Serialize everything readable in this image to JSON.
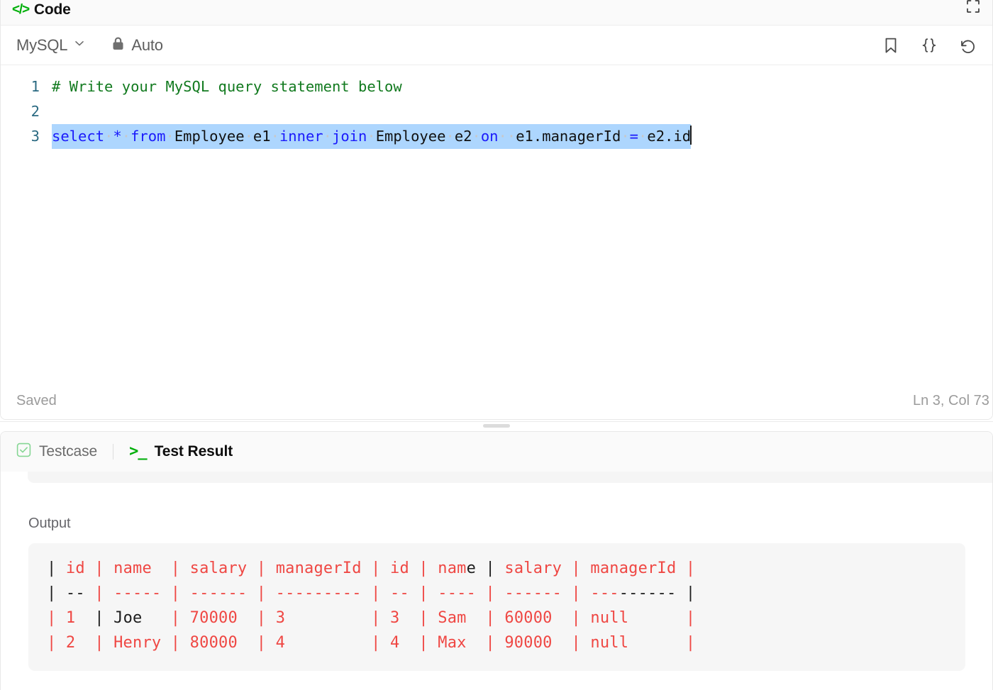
{
  "editor": {
    "header": {
      "icon": "code-brackets-icon",
      "title": "Code",
      "expand_icon": "expand-fullscreen-icon"
    },
    "toolbar": {
      "language": "MySQL",
      "language_chevron": "chevron-down-icon",
      "lock_icon": "lock-icon",
      "autocomplete_label": "Auto",
      "icons": [
        {
          "name": "bookmark-icon",
          "label": "Bookmark"
        },
        {
          "name": "curly-braces-icon",
          "label": "Format code"
        },
        {
          "name": "reset-icon",
          "label": "Reset code"
        }
      ]
    },
    "code": {
      "lines": [
        {
          "number": "1",
          "text": "# Write your MySQL query statement below"
        },
        {
          "number": "2",
          "text": ""
        },
        {
          "number": "3",
          "text": "select * from Employee e1 inner join Employee e2 on  e1.managerId = e2.id"
        }
      ],
      "line_numbers": [
        "1",
        "2",
        "3"
      ],
      "comment_text": "# Write your MySQL query statement below",
      "selected_line_tokens": [
        {
          "t": "select",
          "type": "keyword"
        },
        {
          "t": "*",
          "type": "operator"
        },
        {
          "t": "from",
          "type": "keyword"
        },
        {
          "t": "Employee",
          "type": "plain"
        },
        {
          "t": "e1",
          "type": "plain"
        },
        {
          "t": "inner",
          "type": "keyword"
        },
        {
          "t": "join",
          "type": "keyword"
        },
        {
          "t": "Employee",
          "type": "plain"
        },
        {
          "t": "e2",
          "type": "plain"
        },
        {
          "t": "on",
          "type": "keyword"
        },
        {
          "t": "e1.managerId",
          "type": "plain"
        },
        {
          "t": "=",
          "type": "operator"
        },
        {
          "t": "e2.id",
          "type": "plain"
        }
      ]
    },
    "status": {
      "saved_label": "Saved",
      "cursor_position": "Ln 3, Col 73"
    }
  },
  "console": {
    "tabs": [
      {
        "label": "Testcase",
        "icon": "check-square-icon",
        "active": false
      },
      {
        "label": "Test Result",
        "icon": "terminal-prompt-icon",
        "active": true
      }
    ],
    "output": {
      "label": "Output",
      "columns": [
        "id",
        "name",
        "salary",
        "managerId",
        "id",
        "name",
        "salary",
        "managerId"
      ],
      "rows": [
        [
          "1",
          "Joe",
          "70000",
          "3",
          "3",
          "Sam",
          "60000",
          "null"
        ],
        [
          "2",
          "Henry",
          "80000",
          "4",
          "4",
          "Max",
          "90000",
          "null"
        ]
      ],
      "raw_lines": [
        "| id | name  | salary | managerId | id | name | salary | managerId |",
        "| -- | ----- | ------ | --------- | -- | ---- | ------ | --------- |",
        "| 1  | Joe   | 70000  | 3         | 3  | Sam  | 60000  | null      |",
        "| 2  | Henry | 80000  | 4         | 4  | Max  | 90000  | null      |"
      ]
    }
  },
  "colors": {
    "accent_green": "#00af0a",
    "output_red": "#ef4743",
    "keyword_blue": "#1a1afb",
    "comment_green": "#127a1f",
    "selection_blue": "#add6fe",
    "gutter_blue": "#2b6a82"
  }
}
